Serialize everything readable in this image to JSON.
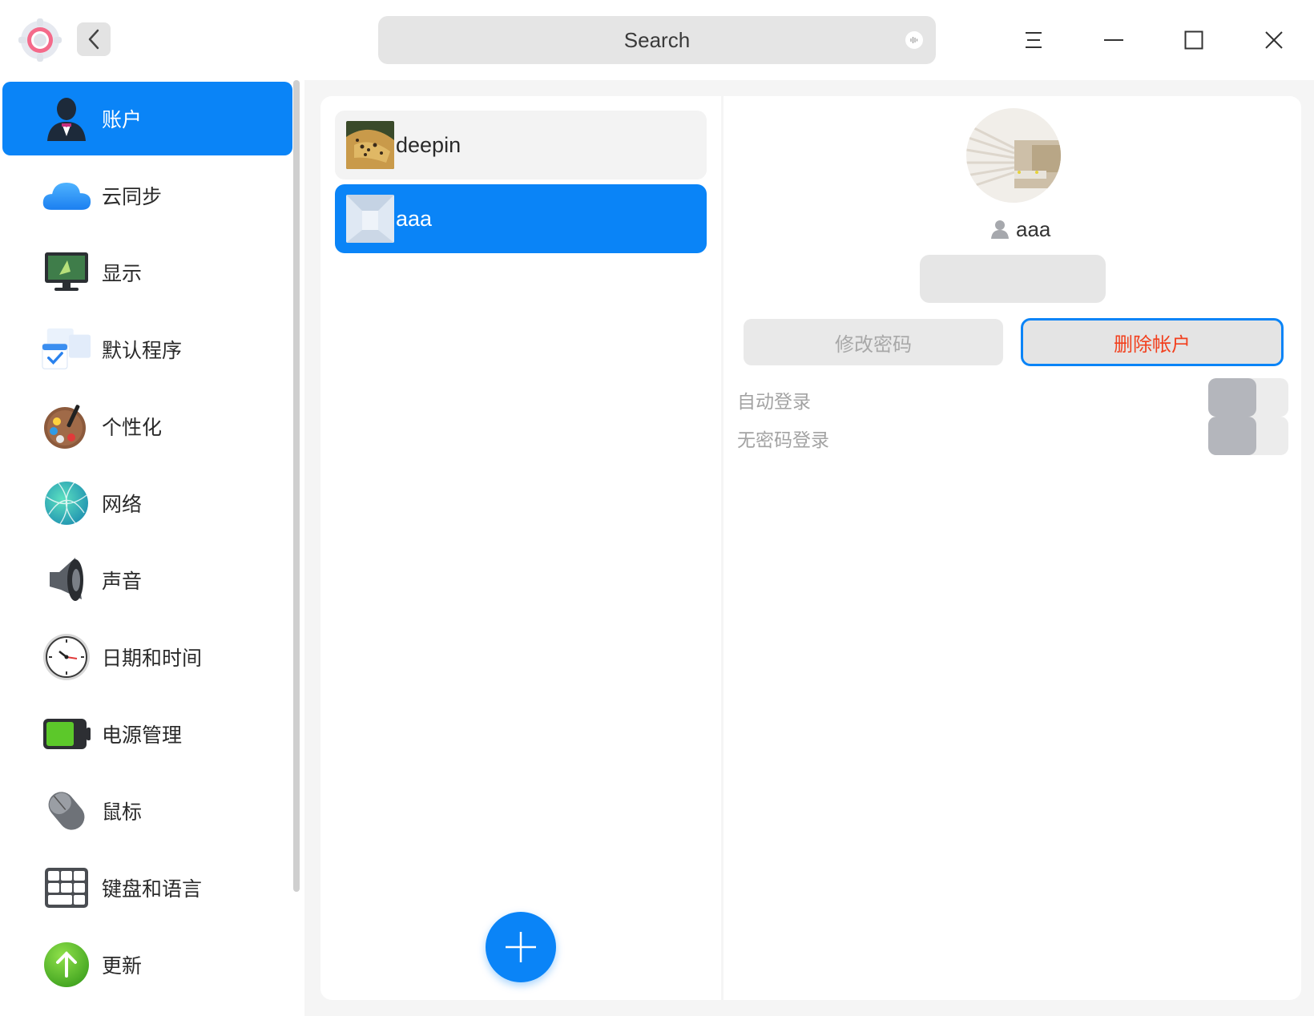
{
  "titlebar": {
    "search_placeholder": "Search",
    "icons": [
      "settings-app-icon",
      "back-icon",
      "voice-icon",
      "menu-icon",
      "minimize-icon",
      "maximize-icon",
      "close-icon"
    ]
  },
  "sidebar": {
    "items": [
      {
        "label": "账户",
        "icon": "account-icon",
        "active": true
      },
      {
        "label": "云同步",
        "icon": "cloud-icon"
      },
      {
        "label": "显示",
        "icon": "display-icon"
      },
      {
        "label": "默认程序",
        "icon": "default-apps-icon"
      },
      {
        "label": "个性化",
        "icon": "palette-icon"
      },
      {
        "label": "网络",
        "icon": "network-icon"
      },
      {
        "label": "声音",
        "icon": "speaker-icon"
      },
      {
        "label": "日期和时间",
        "icon": "clock-icon"
      },
      {
        "label": "电源管理",
        "icon": "battery-icon"
      },
      {
        "label": "鼠标",
        "icon": "mouse-icon"
      },
      {
        "label": "键盘和语言",
        "icon": "keyboard-icon"
      },
      {
        "label": "更新",
        "icon": "update-icon"
      }
    ]
  },
  "accounts": {
    "users": [
      {
        "name": "deepin",
        "selected": false
      },
      {
        "name": "aaa",
        "selected": true
      }
    ],
    "add_icon": "plus-icon"
  },
  "detail": {
    "username": "aaa",
    "fullname_value": "",
    "change_password": "修改密码",
    "delete_account": "删除帐户",
    "auto_login": "自动登录",
    "passwordless_login": "无密码登录",
    "auto_login_on": false,
    "passwordless_login_on": false
  },
  "colors": {
    "accent": "#0a84f7",
    "danger_text": "#f2401e",
    "switch_knob": "#b4b6bc"
  }
}
